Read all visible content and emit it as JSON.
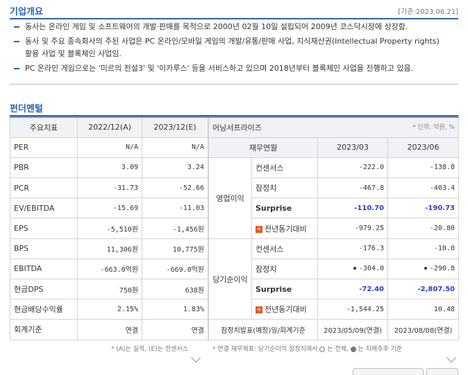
{
  "overview": {
    "title": "기업개요",
    "as_of": "[기준:2023.06.21]",
    "bullets": [
      "동사는 온라인 게임 및 소프트웨어의 개발·판매를 목적으로 2000년 02월 10일 설립되어 2009년 코스닥시장에 상장함.",
      "동사 및 주요 종속회사의 주된 사업은 PC 온라인/모바일 게임의 개발/유통/판매 사업, 지식재산권(Intellectual Property rights)",
      "활용 사업 및 블록체인 사업임.",
      "PC 온라인 게임으로는 '미르의 전설3' 및 '이카루스' 등을 서비스하고 있으며 2018년부터 블록체인 사업을 진행하고 있음."
    ]
  },
  "fundamental": {
    "title": "펀더멘털",
    "headers": [
      "주요지표",
      "2022/12(A)",
      "2023/12(E)"
    ],
    "rows": [
      {
        "label": "PER",
        "a": "N/A",
        "e": "N/A"
      },
      {
        "label": "PBR",
        "a": "3.09",
        "e": "3.24"
      },
      {
        "label": "PCR",
        "a": "-31.73",
        "e": "-52.66"
      },
      {
        "label": "EV/EBITDA",
        "a": "-15.69",
        "e": "-11.03"
      },
      {
        "label": "EPS",
        "a": "-5,510원",
        "e": "-1,456원"
      },
      {
        "label": "BPS",
        "a": "11,306원",
        "e": "10,775원"
      },
      {
        "label": "EBITDA",
        "a": "-663.0억원",
        "e": "-669.0억원"
      },
      {
        "label": "현금DPS",
        "a": "750원",
        "e": "638원"
      },
      {
        "label": "현금배당수익률",
        "a": "2.15%",
        "e": "1.83%"
      },
      {
        "label": "회계기준",
        "a": "연결",
        "e": "연결"
      }
    ],
    "note": "* (A)는 실적, (E)는 컨센서스"
  },
  "earnings": {
    "company": "어닝서프라이즈",
    "unit": "* 단위: 억원, %",
    "sub_headers": [
      "재무연월",
      "2023/03",
      "2023/06"
    ],
    "groups": [
      {
        "name": "영업이익",
        "rows": [
          {
            "label": "컨센서스",
            "q1": "-222.0",
            "q2": "-138.8"
          },
          {
            "label": "잠정치",
            "q1": "-467.8",
            "q2": "-403.4"
          },
          {
            "label": "Surprise",
            "q1": "-110.70",
            "q2": "-190.73"
          },
          {
            "label": "전년동기대비",
            "q1": "-979.25",
            "q2": "-20.80"
          }
        ]
      },
      {
        "name": "당기순이익",
        "rows": [
          {
            "label": "컨센서스",
            "q1": "-176.3",
            "q2": "-10.0"
          },
          {
            "label": "잠정치",
            "q1": "-304.0",
            "q2": "-290.8"
          },
          {
            "label": "Surprise",
            "q1": "-72.40",
            "q2": "-2,807.50"
          },
          {
            "label": "전년동기대비",
            "q1": "-1,544.25",
            "q2": "10.48"
          }
        ]
      }
    ],
    "footer_row": {
      "label": "잠정치발표(예정)일/회계기준",
      "q1": "2023/05/09(연결)",
      "q2": "2023/08/08(연결)"
    },
    "note_prefix": "* 연결 재무제표: 당기순이익 잠정치에서",
    "note_open": "는 전체,",
    "note_filled": "는 지배주주 기준"
  }
}
